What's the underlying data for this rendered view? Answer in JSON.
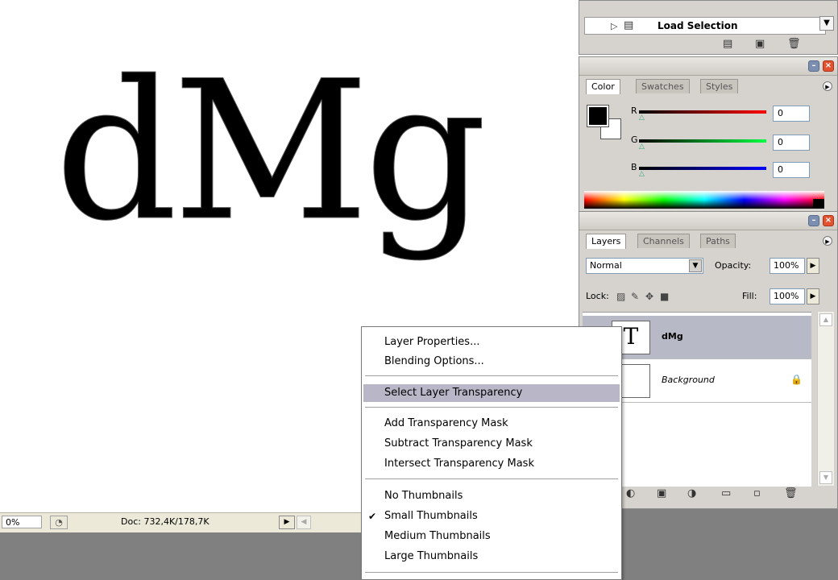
{
  "canvas": {
    "text": "dMg"
  },
  "statusbar": {
    "zoom": "0%",
    "doc": "Doc: 732,4K/178,7K"
  },
  "actions": {
    "row_label": "Load Selection"
  },
  "color_panel": {
    "tabs": [
      "Color",
      "Swatches",
      "Styles"
    ],
    "r_label": "R",
    "g_label": "G",
    "b_label": "B",
    "r_value": "0",
    "g_value": "0",
    "b_value": "0",
    "colors": {
      "foreground": "#000000",
      "background": "#ffffff",
      "r_track": "#d00000",
      "g_track": "#00c040",
      "b_track": "#0000d0"
    }
  },
  "layers_panel": {
    "tabs": [
      "Layers",
      "Channels",
      "Paths"
    ],
    "blend_mode": "Normal",
    "opacity_label": "Opacity:",
    "opacity_value": "100%",
    "lock_label": "Lock:",
    "fill_label": "Fill:",
    "fill_value": "100%",
    "layers": [
      {
        "name": "dMg",
        "thumb": "T",
        "selected": true
      },
      {
        "name": "Background",
        "thumb": "",
        "selected": false
      }
    ]
  },
  "context_menu": {
    "items": [
      {
        "label": "Layer Properties...",
        "group": 1
      },
      {
        "label": "Blending Options...",
        "group": 1
      },
      {
        "label": "Select Layer Transparency",
        "group": 2,
        "highlighted": true
      },
      {
        "label": "Add Transparency Mask",
        "group": 3
      },
      {
        "label": "Subtract Transparency Mask",
        "group": 3
      },
      {
        "label": "Intersect Transparency Mask",
        "group": 3
      },
      {
        "label": "No Thumbnails",
        "group": 4
      },
      {
        "label": "Small Thumbnails",
        "group": 4,
        "checked": true
      },
      {
        "label": "Medium Thumbnails",
        "group": 4
      },
      {
        "label": "Large Thumbnails",
        "group": 4
      }
    ]
  }
}
